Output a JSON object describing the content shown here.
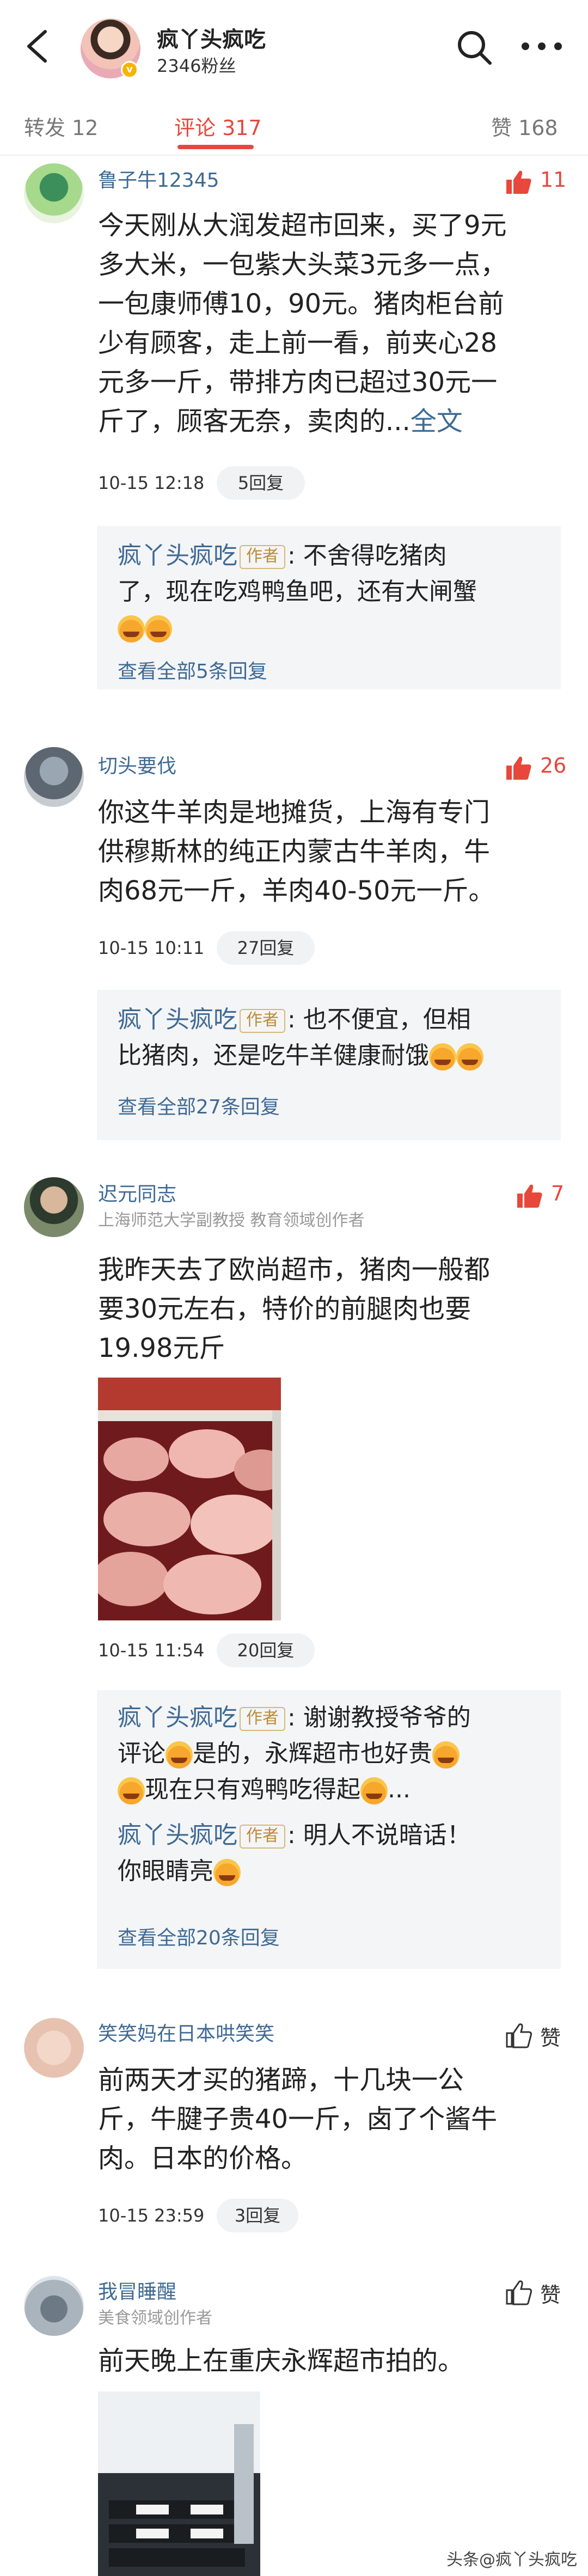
{
  "header": {
    "author_name": "疯丫头疯吃",
    "fans": "2346粉丝",
    "verified_icon": "v-badge-icon",
    "back_icon": "back-icon",
    "search_icon": "search-icon",
    "more_icon": "more-icon"
  },
  "tabs": {
    "repost": "转发 12",
    "comments": "评论 317",
    "likes": "赞 168"
  },
  "comments": [
    {
      "name": "鲁子牛12345",
      "likes": "11",
      "text_lines": [
        "今天刚从大润发超市回来，买了9元",
        "多大米，一包紫大头菜3元多一点，",
        "一包康师傅10，90元。猪肉柜台前",
        "少有顾客，走上前一看，前夹心28",
        "元多一斤，带排方肉已超过30元一",
        "斤了，顾客无奈，卖肉的..."
      ],
      "full_text_link": "全文",
      "time": "10-15 12:18",
      "reply_count": "5回复",
      "replies": [
        {
          "name": "疯丫头疯吃",
          "tag": "作者",
          "lines": [
            ": 不舍得吃猪肉",
            "了，现在吃鸡鸭鱼吧，还有大闸蟹"
          ],
          "emoji_line": true
        }
      ],
      "view_all": "查看全部5条回复"
    },
    {
      "name": "切头要伐",
      "likes": "26",
      "text_lines": [
        "你这牛羊肉是地摊货，上海有专门",
        "供穆斯林的纯正内蒙古牛羊肉，牛",
        "肉68元一斤，羊肉40-50元一斤。"
      ],
      "time": "10-15 10:11",
      "reply_count": "27回复",
      "replies": [
        {
          "name": "疯丫头疯吃",
          "tag": "作者",
          "lines": [
            ": 也不便宜，但相",
            "比猪肉，还是吃牛羊健康耐饿"
          ]
        }
      ],
      "view_all": "查看全部27条回复"
    },
    {
      "name": "迟元同志",
      "subtitle": "上海师范大学副教授 教育领域创作者",
      "likes": "7",
      "text_lines": [
        "我昨天去了欧尚超市，猪肉一般都",
        "要30元左右，特价的前腿肉也要",
        "19.98元斤"
      ],
      "time": "10-15 11:54",
      "reply_count": "20回复",
      "replies": [
        {
          "name": "疯丫头疯吃",
          "tag": "作者",
          "lines": [
            ": 谢谢教授爷爷的",
            "评论",
            "是的，永辉超市也好贵",
            "现在只有鸡鸭吃得起"
          ],
          "ellipsis": "..."
        },
        {
          "name": "疯丫头疯吃",
          "tag": "作者",
          "lines": [
            ": 明人不说暗话！",
            "你眼睛亮"
          ]
        }
      ],
      "view_all": "查看全部20条回复"
    },
    {
      "name": "笑笑妈在日本哄笑笑",
      "likes": "赞",
      "text_lines": [
        "前两天才买的猪蹄，十几块一公",
        "斤，牛腱子贵40一斤，卤了个酱牛",
        "肉。日本的价格。"
      ],
      "time": "10-15 23:59",
      "reply_count": "3回复"
    },
    {
      "name": "我冒睡醒",
      "subtitle": "美食领域创作者",
      "likes": "赞",
      "text_lines": [
        "前天晚上在重庆永辉超市拍的。"
      ]
    }
  ],
  "watermark": "头条@疯丫头疯吃",
  "colors": {
    "accent": "#e8473c",
    "link": "#3f6a94",
    "reply_bg": "#f4f5f7"
  }
}
